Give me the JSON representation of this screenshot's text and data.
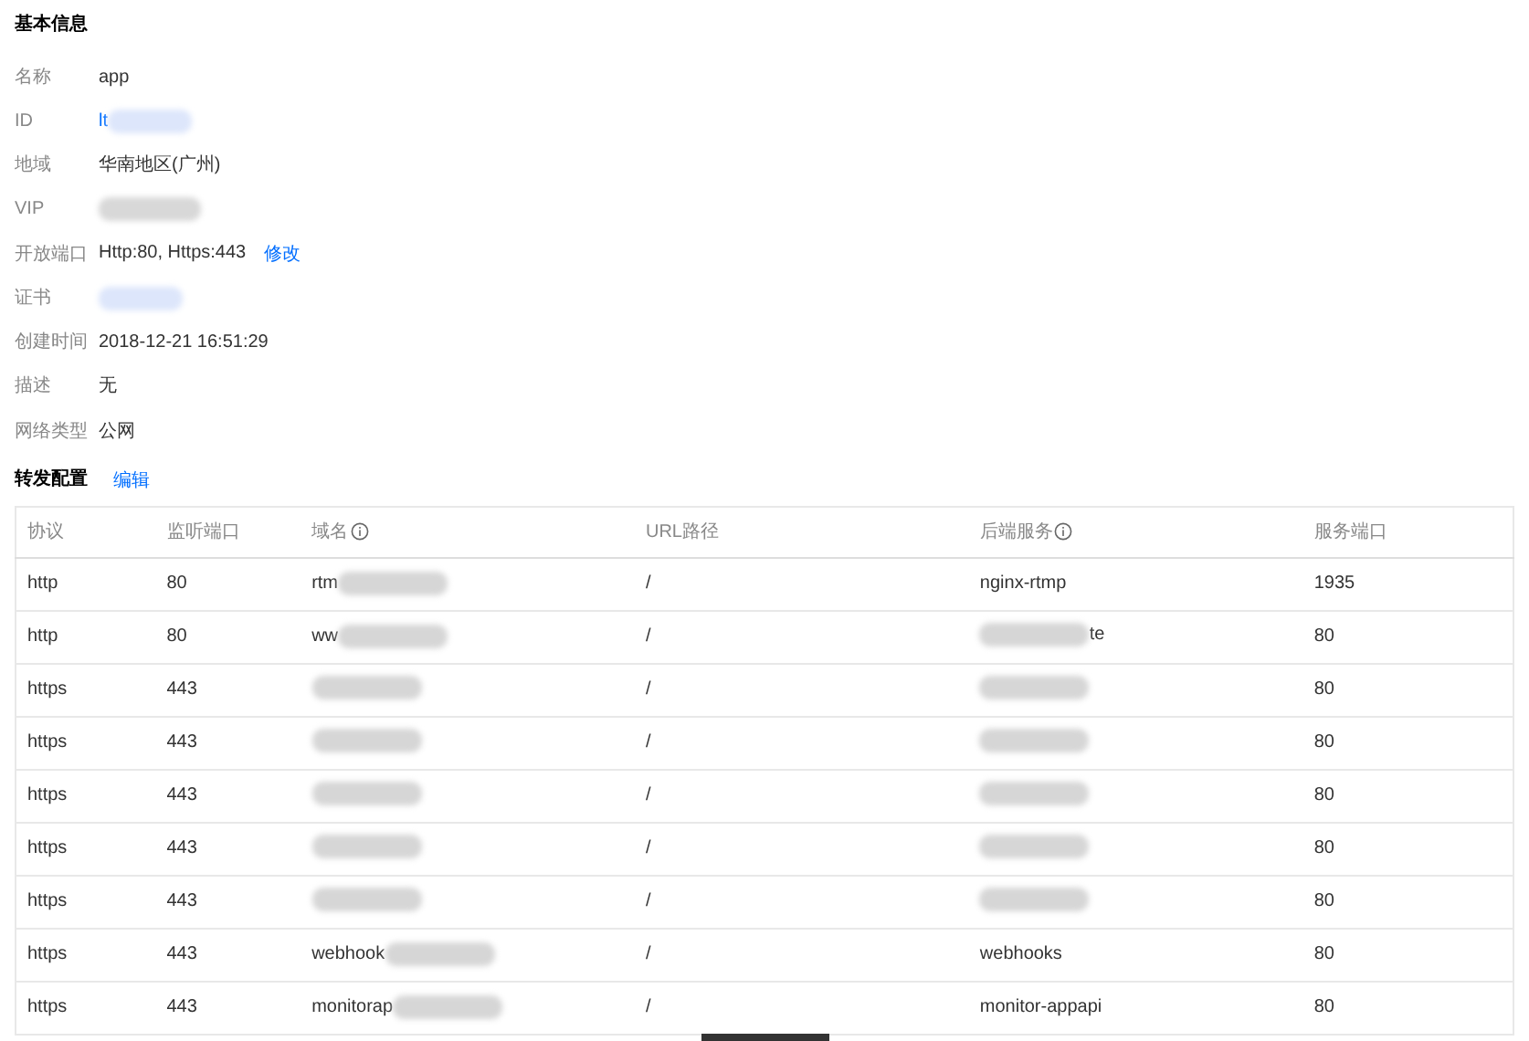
{
  "basic_info": {
    "title": "基本信息",
    "fields": [
      {
        "label": "名称",
        "kind": "text",
        "value": "app",
        "blurred": false
      },
      {
        "label": "ID",
        "kind": "link",
        "value": "lt",
        "blurred": true
      },
      {
        "label": "地域",
        "kind": "text",
        "value": "华南地区(广州)",
        "blurred": false
      },
      {
        "label": "VIP",
        "kind": "text",
        "blurred": true
      },
      {
        "label": "开放端口",
        "kind": "text",
        "value": "Http:80, Https:443",
        "action": "修改",
        "blurred": false
      },
      {
        "label": "证书",
        "kind": "link",
        "blurred": true
      },
      {
        "label": "创建时间",
        "kind": "text",
        "value": "2018-12-21 16:51:29",
        "blurred": false
      },
      {
        "label": "描述",
        "kind": "text",
        "value": "无",
        "blurred": false
      },
      {
        "label": "网络类型",
        "kind": "text",
        "value": "公网",
        "blurred": false
      }
    ]
  },
  "forwarding": {
    "title": "转发配置",
    "action": "编辑",
    "table": {
      "columns": [
        {
          "label": "协议",
          "info": false
        },
        {
          "label": "监听端口",
          "info": false
        },
        {
          "label": "域名",
          "info": true
        },
        {
          "label": "URL路径",
          "info": false
        },
        {
          "label": "后端服务",
          "info": true
        },
        {
          "label": "服务端口",
          "info": false
        }
      ],
      "rows": [
        {
          "protocol": "http",
          "port": "80",
          "domain": {
            "text": "rtm",
            "blurred": true
          },
          "path": "/",
          "backend": {
            "text": "nginx-rtmp",
            "blurred": false
          },
          "service_port": "1935"
        },
        {
          "protocol": "http",
          "port": "80",
          "domain": {
            "text": "ww",
            "blurred": true
          },
          "path": "/",
          "backend": {
            "text": "te",
            "blurred": true,
            "blur_first": true
          },
          "service_port": "80"
        },
        {
          "protocol": "https",
          "port": "443",
          "domain": {
            "blurred": true
          },
          "path": "/",
          "backend": {
            "blurred": true
          },
          "service_port": "80"
        },
        {
          "protocol": "https",
          "port": "443",
          "domain": {
            "blurred": true
          },
          "path": "/",
          "backend": {
            "blurred": true
          },
          "service_port": "80"
        },
        {
          "protocol": "https",
          "port": "443",
          "domain": {
            "blurred": true
          },
          "path": "/",
          "backend": {
            "blurred": true
          },
          "service_port": "80"
        },
        {
          "protocol": "https",
          "port": "443",
          "domain": {
            "blurred": true
          },
          "path": "/",
          "backend": {
            "blurred": true
          },
          "service_port": "80"
        },
        {
          "protocol": "https",
          "port": "443",
          "domain": {
            "blurred": true
          },
          "path": "/",
          "backend": {
            "blurred": true
          },
          "service_port": "80"
        },
        {
          "protocol": "https",
          "port": "443",
          "domain": {
            "text": "webhook",
            "blurred": true
          },
          "path": "/",
          "backend": {
            "text": "webhooks",
            "blurred": false
          },
          "service_port": "80"
        },
        {
          "protocol": "https",
          "port": "443",
          "domain": {
            "text": "monitorap",
            "blurred": true
          },
          "path": "/",
          "backend": {
            "text": "monitor-appapi",
            "blurred": false
          },
          "service_port": "80"
        }
      ]
    }
  }
}
